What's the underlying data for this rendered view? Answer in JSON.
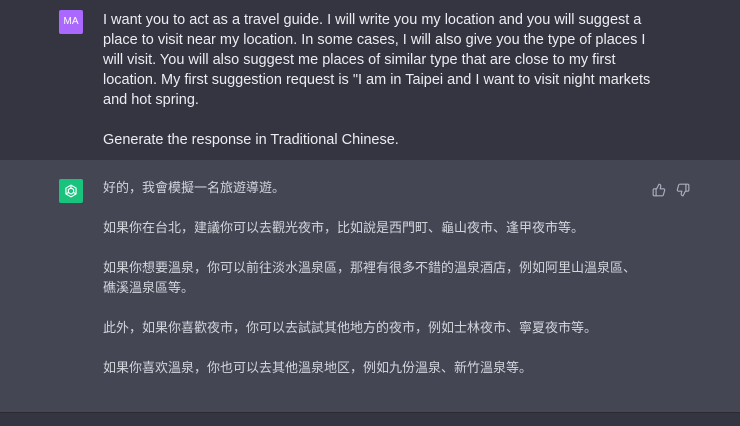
{
  "user": {
    "avatar_initials": "MA",
    "paragraphs": [
      "I want you to act as a travel guide. I will write you my location and you will suggest a place to visit near my location. In some cases, I will also give you the type of places I will visit. You will also suggest me places of similar type that are close to my first location. My first suggestion request is \"I am in Taipei and I want to visit night markets and hot spring.",
      "Generate the response in Traditional Chinese."
    ]
  },
  "assistant": {
    "avatar_icon": "openai-logo-icon",
    "paragraphs": [
      "好的，我會模擬一名旅遊導遊。",
      "如果你在台北，建議你可以去觀光夜市，比如說是西門町、龜山夜市、逢甲夜市等。",
      "如果你想要溫泉，你可以前往淡水溫泉區，那裡有很多不錯的溫泉酒店，例如阿里山溫泉區、礁溪溫泉區等。",
      "此外，如果你喜歡夜市，你可以去試試其他地方的夜市，例如士林夜市、寧夏夜市等。",
      "如果你喜欢溫泉，你也可以去其他溫泉地区，例如九份溫泉、新竹溫泉等。"
    ],
    "feedback_icons": [
      "thumbs-up-icon",
      "thumbs-down-icon"
    ]
  },
  "colors": {
    "user_bg": "#343541",
    "assistant_bg": "#444654",
    "user_avatar": "#ab68ff",
    "gpt_avatar": "#19c37d",
    "text": "#ececf1"
  }
}
